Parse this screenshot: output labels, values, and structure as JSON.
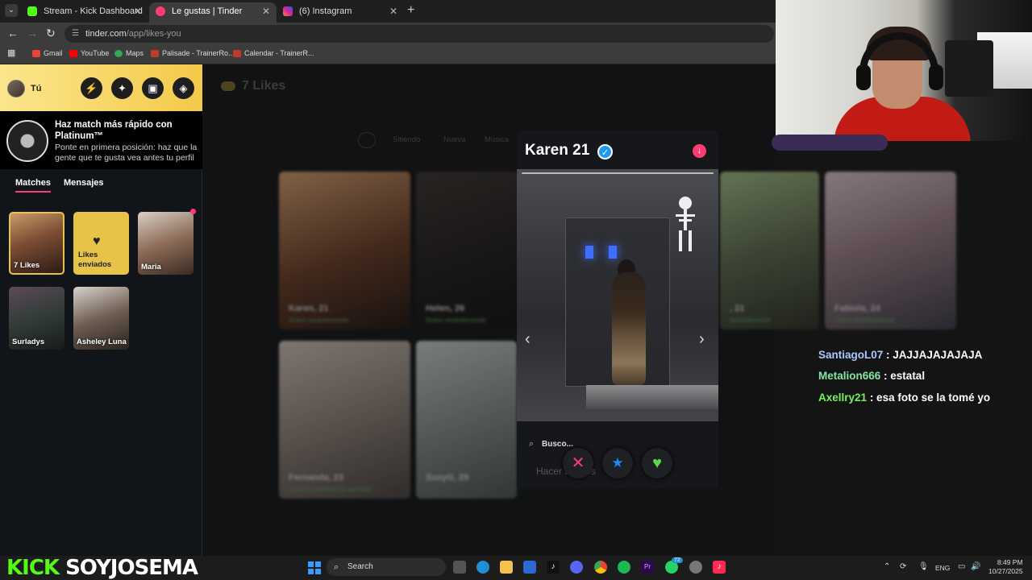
{
  "browser": {
    "tabs": [
      {
        "label": "Stream - Kick Dashboard",
        "active": false,
        "color": "#53fc18"
      },
      {
        "label": "Le gustas | Tinder",
        "active": true,
        "color": "#fe3c72"
      },
      {
        "label": "(6) Instagram",
        "active": false,
        "color": "#d6249f"
      }
    ],
    "url_host": "tinder.com",
    "url_path": "/app/likes-you",
    "bookmarks": [
      "Gmail",
      "YouTube",
      "Maps",
      "Palisade - TrainerRo...",
      "Calendar - TrainerR..."
    ]
  },
  "sidebar": {
    "user_label": "Tú",
    "promo_title": "Haz match más rápido con Platinum™",
    "promo_text": "Ponte en primera posición: haz que la gente que te gusta vea antes tu perfil",
    "tabs": [
      "Matches",
      "Mensajes"
    ],
    "cards": [
      {
        "label": "7 Likes"
      },
      {
        "label": "Likes enviados"
      },
      {
        "label": "Maria"
      },
      {
        "label": "Surladys"
      },
      {
        "label": "Asheley Luna"
      }
    ]
  },
  "main": {
    "title": "7 Likes",
    "filters": [
      "Sitiendo",
      "Nueva",
      "Música"
    ],
    "blur_cards": [
      {
        "name": "Karen, 21",
        "sub": "Activo recientemente"
      },
      {
        "name": "Helen, 26",
        "sub": "Activo recientemente"
      },
      {
        "name": ", 21",
        "sub": "recientemente"
      },
      {
        "name": "Fabiola, 24",
        "sub": "Activo recientemente"
      },
      {
        "name": "Fernanda, 23",
        "sub": "servicio nacional de aprendiz..."
      },
      {
        "name": "SusyG, 29",
        "sub": ""
      }
    ]
  },
  "profile": {
    "name": "Karen 21",
    "search_label": "Busco...",
    "looking_for": "Hacer amigos",
    "actions": [
      "nope",
      "super-like",
      "like"
    ]
  },
  "chat": [
    {
      "user": "SantiagoL07",
      "color": "#a9c9ff",
      "message": ": JAJJAJAJAJAJA"
    },
    {
      "user": "Metalion666",
      "color": "#86e5a3",
      "message": ": estatal"
    },
    {
      "user": "Axellry21",
      "color": "#78f05a",
      "message": ": esa foto se la tomé yo"
    }
  ],
  "overlay": {
    "brand": "KICK",
    "channel": "SOYJOSEMA"
  },
  "taskbar": {
    "search_placeholder": "Search",
    "language": "ENG",
    "time": "8:49 PM",
    "date": "10/27/2025",
    "badge_count": "72"
  }
}
